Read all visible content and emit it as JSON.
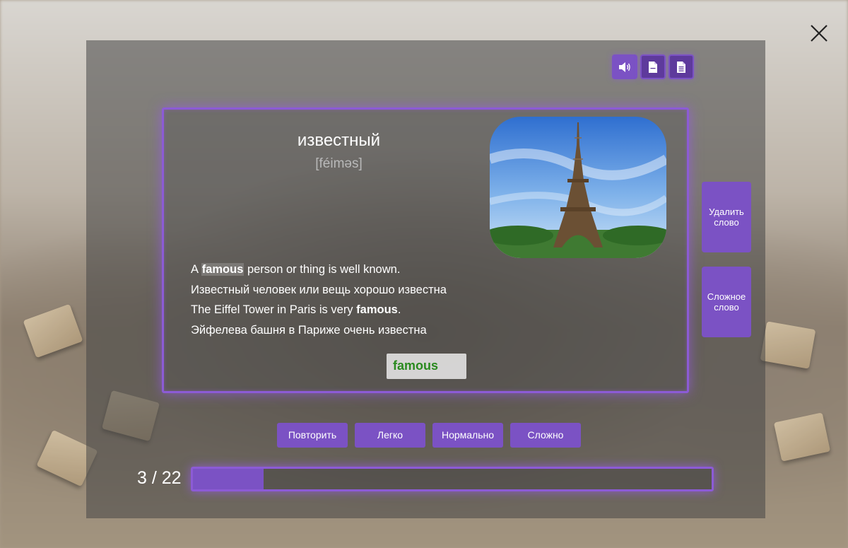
{
  "toolbar": {
    "sound_icon": "speaker-icon",
    "doc_icon": "document-icon",
    "text_icon": "text-document-icon"
  },
  "card": {
    "word": "известный",
    "transcription": "[féiməs]",
    "examples": [
      {
        "before": "A ",
        "highlight": "famous",
        "after": " person or thing is well known."
      },
      {
        "text": "Известный человек или вещь хорошо известна"
      },
      {
        "before": "The Eiffel Tower in Paris is very ",
        "highlight": "famous",
        "after": "."
      },
      {
        "text": "Эйфелева башня в Париже очень известна"
      }
    ],
    "answer": "famous"
  },
  "side_buttons": {
    "delete": "Удалить слово",
    "hard_word": "Сложное слово"
  },
  "answer_buttons": [
    "Повторить",
    "Легко",
    "Нормально",
    "Сложно"
  ],
  "progress": {
    "current": 3,
    "total": 22,
    "label": "3 / 22",
    "fraction": 0.136
  },
  "colors": {
    "accent": "#7b52c4",
    "answer_text": "#2a8a1f"
  }
}
